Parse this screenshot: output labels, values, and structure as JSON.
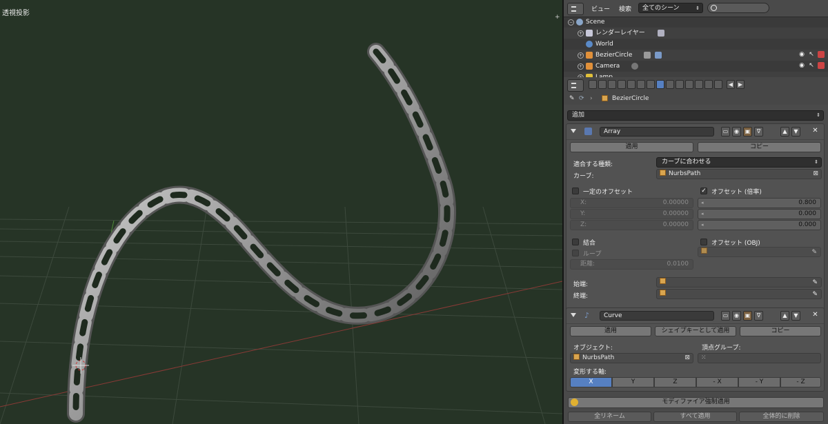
{
  "viewport": {
    "label": "透視投影",
    "plus": "+"
  },
  "outliner": {
    "menu": [
      "ビュー",
      "検索"
    ],
    "scene_select": "全てのシーン",
    "rows": [
      {
        "label": "Scene"
      },
      {
        "label": "レンダーレイヤー"
      },
      {
        "label": "World"
      },
      {
        "label": "BezierCircle"
      },
      {
        "label": "Camera"
      },
      {
        "label": "Lamp"
      }
    ]
  },
  "properties": {
    "breadcrumb": "BezierCircle",
    "add_modifier": "追加",
    "array": {
      "name": "Array",
      "apply": "適用",
      "copy": "コピー",
      "fit_type_label": "適合する種類:",
      "fit_type_value": "カーブに合わせる",
      "curve_label": "カーブ:",
      "curve_value": "NurbsPath",
      "constant_offset": "一定のオフセット",
      "relative_offset": "オフセット (倍率)",
      "const_x_label": "X:",
      "const_x": "0.00000",
      "const_y_label": "Y:",
      "const_y": "0.00000",
      "const_z_label": "Z:",
      "const_z": "0.00000",
      "rel_x": "0.800",
      "rel_y": "0.000",
      "rel_z": "0.000",
      "merge": "結合",
      "object_offset": "オフセット (OBJ)",
      "loop": "ループ",
      "distance_label": "距離:",
      "distance": "0.0100",
      "start_cap": "始端:",
      "end_cap": "終端:"
    },
    "curve": {
      "name": "Curve",
      "apply": "適用",
      "apply_shape": "シェイプキーとして適用",
      "copy": "コピー",
      "object_label": "オブジェクト:",
      "object_value": "NurbsPath",
      "vgroup_label": "頂点グループ:",
      "deform_axis_label": "変形する軸:",
      "axes": [
        "X",
        "Y",
        "Z",
        "- X",
        "- Y",
        "- Z"
      ]
    },
    "force_apply": "モディファイア強制適用",
    "bottom": [
      "全リネーム",
      "すべて適用",
      "全体的に削除"
    ]
  },
  "colors": {
    "viewport_bg": "#263426",
    "accent": "#5680c2"
  }
}
